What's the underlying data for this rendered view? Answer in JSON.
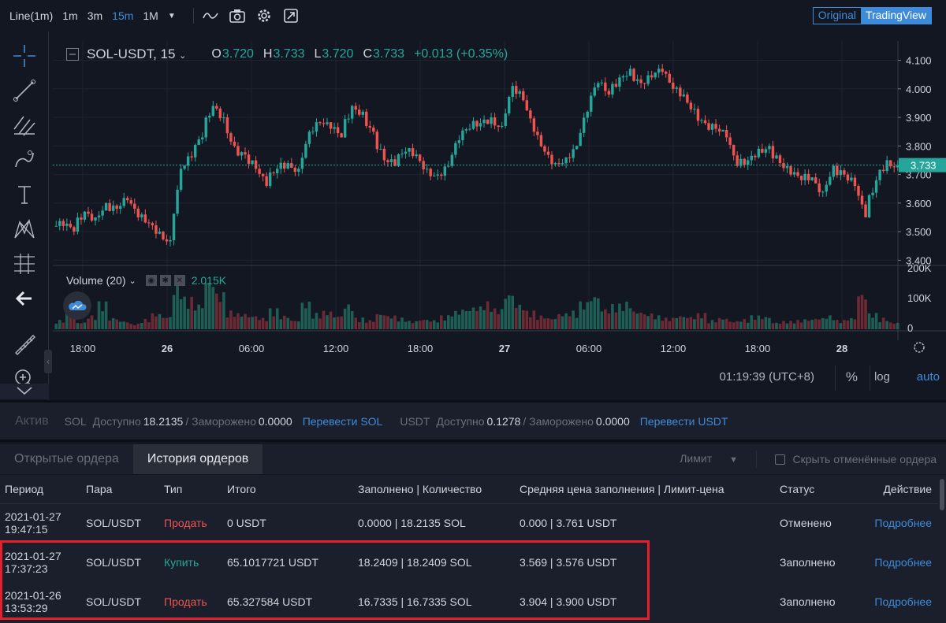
{
  "toolbar": {
    "chart_type": "Line(1m)",
    "intervals": [
      "1m",
      "3m",
      "15m",
      "1M"
    ],
    "active_interval": "15m",
    "views": [
      "Original",
      "TradingView"
    ],
    "selected_view": "TradingView"
  },
  "legend": {
    "symbol": "SOL-USDT, 15",
    "o_label": "O",
    "o": "3.720",
    "h_label": "H",
    "h": "3.733",
    "l_label": "L",
    "l": "3.720",
    "c_label": "C",
    "c": "3.733",
    "change": "+0.013 (+0.35%)"
  },
  "volume": {
    "label": "Volume (20)",
    "value": "2.015K"
  },
  "chart_data": {
    "type": "candlestick",
    "price_axis": [
      "4.100",
      "4.000",
      "3.900",
      "3.800",
      "3.700",
      "3.600",
      "3.500",
      "3.400"
    ],
    "price_range": [
      3.39,
      4.14
    ],
    "last_price": "3.733",
    "volume_axis": [
      "200K",
      "100K",
      "0"
    ],
    "x_ticks": [
      "18:00",
      "26",
      "06:00",
      "12:00",
      "18:00",
      "27",
      "06:00",
      "12:00",
      "18:00",
      "28"
    ],
    "bold_ticks": [
      "26",
      "27",
      "28"
    ],
    "close_path": [
      3.52,
      3.5,
      3.57,
      3.55,
      3.6,
      3.58,
      3.61,
      3.55,
      3.53,
      3.5,
      3.47,
      3.72,
      3.76,
      3.83,
      3.94,
      3.9,
      3.8,
      3.77,
      3.72,
      3.66,
      3.72,
      3.74,
      3.72,
      3.85,
      3.88,
      3.86,
      3.83,
      3.94,
      3.92,
      3.85,
      3.75,
      3.73,
      3.78,
      3.77,
      3.72,
      3.7,
      3.73,
      3.82,
      3.86,
      3.88,
      3.9,
      3.87,
      4.01,
      3.96,
      3.85,
      3.78,
      3.74,
      3.76,
      3.8,
      3.92,
      4.02,
      3.98,
      4.04,
      4.07,
      4.02,
      4.04,
      4.06,
      4.0,
      3.98,
      3.93,
      3.88,
      3.86,
      3.83,
      3.73,
      3.75,
      3.79,
      3.8,
      3.74,
      3.7,
      3.68,
      3.69,
      3.64,
      3.73,
      3.7,
      3.66,
      3.55,
      3.68,
      3.75,
      3.733
    ],
    "volume_path": [
      20,
      40,
      15,
      30,
      60,
      25,
      18,
      12,
      22,
      35,
      28,
      95,
      70,
      55,
      110,
      80,
      40,
      35,
      30,
      25,
      45,
      30,
      20,
      60,
      35,
      40,
      30,
      55,
      25,
      20,
      35,
      30,
      25,
      18,
      22,
      20,
      30,
      40,
      45,
      50,
      60,
      45,
      80,
      55,
      40,
      30,
      25,
      35,
      40,
      60,
      75,
      45,
      55,
      60,
      40,
      35,
      30,
      25,
      30,
      28,
      35,
      20,
      25,
      18,
      22,
      30,
      28,
      15,
      18,
      20,
      22,
      25,
      30,
      20,
      25,
      80,
      35,
      25,
      15
    ]
  },
  "status": {
    "time": "01:19:39 (UTC+8)",
    "percent": "%",
    "log": "log",
    "auto": "auto"
  },
  "asset": {
    "title": "Актив",
    "sol_name": "SOL",
    "available_label": "Доступно",
    "sol_available": "18.2135",
    "frozen_label": "/ Заморожено",
    "sol_frozen": "0.0000",
    "sol_transfer": "Перевести SOL",
    "usdt_name": "USDT",
    "usdt_available": "0.1278",
    "usdt_frozen": "0.0000",
    "usdt_transfer": "Перевести USDT"
  },
  "orders": {
    "tabs": [
      "Открытые ордера",
      "История ордеров"
    ],
    "filter": "Лимит",
    "hide_cancelled": "Скрыть отменённые ордера",
    "columns": [
      "Период",
      "Пара",
      "Тип",
      "Итого",
      "Заполнено | Количество",
      "Средняя цена заполнения | Лимит-цена",
      "Статус",
      "Действие"
    ],
    "rows": [
      {
        "date": "2021-01-27",
        "time": "19:47:15",
        "pair": "SOL/USDT",
        "type": "Продать",
        "side": "sell",
        "total": "0 USDT",
        "filled": "0.0000 | 18.2135 SOL",
        "price": "0.000 | 3.761 USDT",
        "status": "Отменено",
        "action": "Подробнее"
      },
      {
        "date": "2021-01-27",
        "time": "17:37:23",
        "pair": "SOL/USDT",
        "type": "Купить",
        "side": "buy",
        "total": "65.1017721 USDT",
        "filled": "18.2409 | 18.2409 SOL",
        "price": "3.569 | 3.576 USDT",
        "status": "Заполнено",
        "action": "Подробнее"
      },
      {
        "date": "2021-01-26",
        "time": "13:53:29",
        "pair": "SOL/USDT",
        "type": "Продать",
        "side": "sell",
        "total": "65.327584 USDT",
        "filled": "16.7335 | 16.7335 SOL",
        "price": "3.904 | 3.900 USDT",
        "status": "Заполнено",
        "action": "Подробнее"
      }
    ]
  },
  "colors": {
    "up": "#26a69a",
    "down": "#ef5350",
    "accent": "#3d8bd9",
    "highlight": "#e3202b"
  }
}
